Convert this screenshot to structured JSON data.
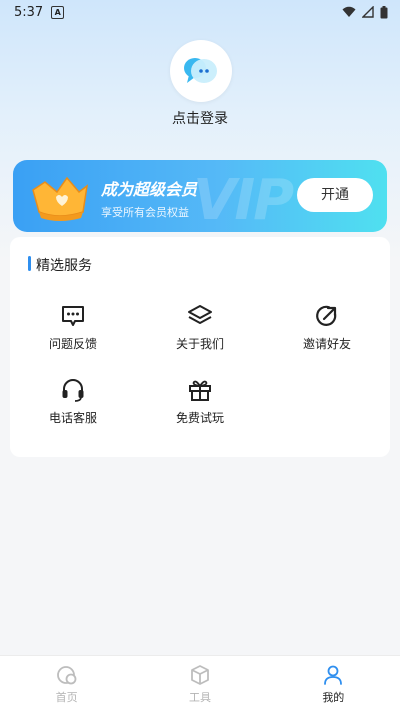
{
  "status_bar": {
    "time": "5:37",
    "app_badge": "A"
  },
  "profile": {
    "login_label": "点击登录"
  },
  "vip": {
    "title": "成为超级会员",
    "subtitle": "享受所有会员权益",
    "button": "开通",
    "watermark": "VIP"
  },
  "services": {
    "title": "精选服务",
    "items": [
      {
        "label": "问题反馈",
        "icon": "feedback-icon"
      },
      {
        "label": "关于我们",
        "icon": "layers-icon"
      },
      {
        "label": "邀请好友",
        "icon": "share-icon"
      },
      {
        "label": "电话客服",
        "icon": "headset-icon"
      },
      {
        "label": "免费试玩",
        "icon": "gift-icon"
      }
    ]
  },
  "tabbar": {
    "items": [
      {
        "label": "首页",
        "icon": "home-icon"
      },
      {
        "label": "工具",
        "icon": "box-icon"
      },
      {
        "label": "我的",
        "icon": "profile-icon"
      }
    ],
    "active_index": 2
  },
  "colors": {
    "accent": "#2f8fef",
    "vip_start": "#3aa0f4",
    "vip_end": "#4fe0f0"
  }
}
